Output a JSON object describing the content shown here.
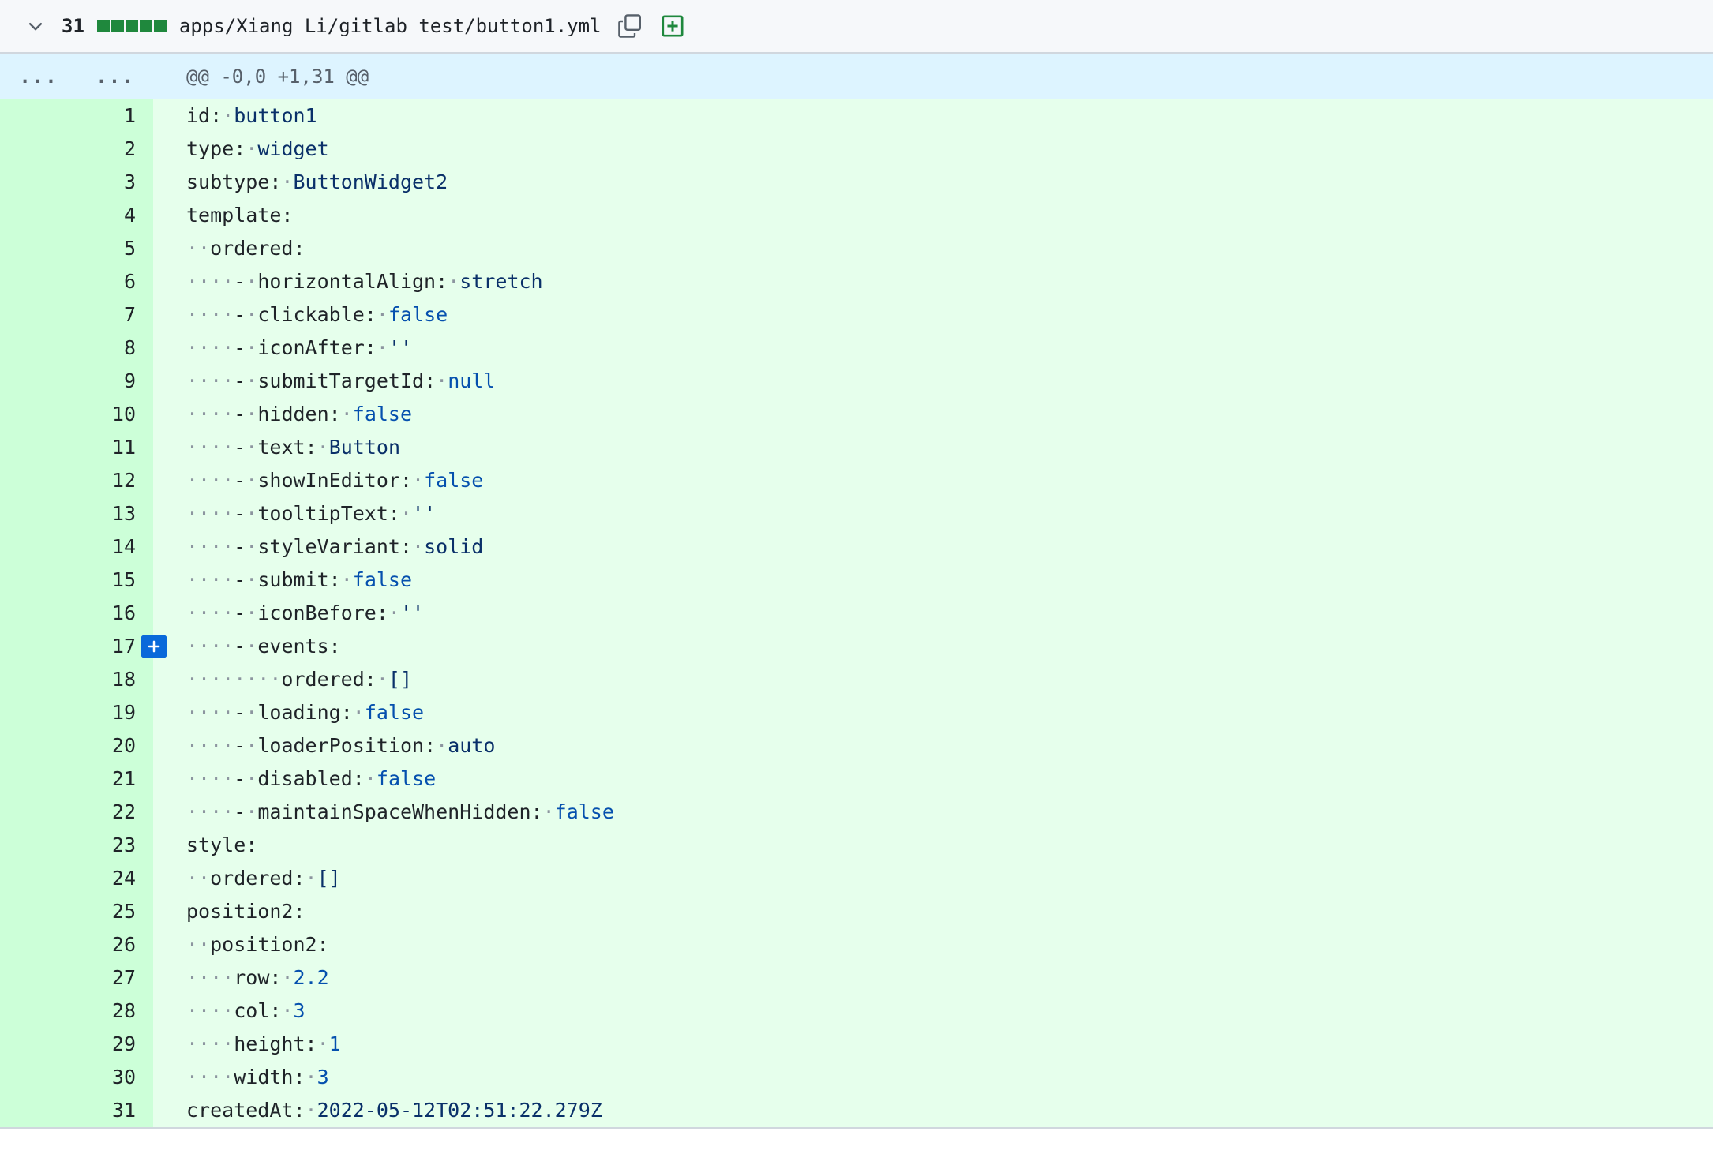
{
  "file": {
    "additions": "31",
    "diffstat_blocks": 5,
    "path": "apps/Xiang Li/gitlab test/button1.yml",
    "icons": [
      "chevron-down-icon",
      "copy-icon",
      "plus-square-icon"
    ]
  },
  "hunk": {
    "expand_old": "...",
    "expand_new": "...",
    "header": "@@ -0,0 +1,31 @@"
  },
  "lines": [
    {
      "n": "1",
      "indent": 0,
      "dash": false,
      "key": "id",
      "val": "button1",
      "vtype": "str"
    },
    {
      "n": "2",
      "indent": 0,
      "dash": false,
      "key": "type",
      "val": "widget",
      "vtype": "str"
    },
    {
      "n": "3",
      "indent": 0,
      "dash": false,
      "key": "subtype",
      "val": "ButtonWidget2",
      "vtype": "str"
    },
    {
      "n": "4",
      "indent": 0,
      "dash": false,
      "key": "template",
      "val": "",
      "vtype": "str"
    },
    {
      "n": "5",
      "indent": 2,
      "dash": false,
      "key": "ordered",
      "val": "",
      "vtype": "str"
    },
    {
      "n": "6",
      "indent": 4,
      "dash": true,
      "key": "horizontalAlign",
      "val": "stretch",
      "vtype": "str"
    },
    {
      "n": "7",
      "indent": 4,
      "dash": true,
      "key": "clickable",
      "val": "false",
      "vtype": "lit"
    },
    {
      "n": "8",
      "indent": 4,
      "dash": true,
      "key": "iconAfter",
      "val": "''",
      "vtype": "str"
    },
    {
      "n": "9",
      "indent": 4,
      "dash": true,
      "key": "submitTargetId",
      "val": "null",
      "vtype": "lit"
    },
    {
      "n": "10",
      "indent": 4,
      "dash": true,
      "key": "hidden",
      "val": "false",
      "vtype": "lit"
    },
    {
      "n": "11",
      "indent": 4,
      "dash": true,
      "key": "text",
      "val": "Button",
      "vtype": "str"
    },
    {
      "n": "12",
      "indent": 4,
      "dash": true,
      "key": "showInEditor",
      "val": "false",
      "vtype": "lit"
    },
    {
      "n": "13",
      "indent": 4,
      "dash": true,
      "key": "tooltipText",
      "val": "''",
      "vtype": "str"
    },
    {
      "n": "14",
      "indent": 4,
      "dash": true,
      "key": "styleVariant",
      "val": "solid",
      "vtype": "str"
    },
    {
      "n": "15",
      "indent": 4,
      "dash": true,
      "key": "submit",
      "val": "false",
      "vtype": "lit"
    },
    {
      "n": "16",
      "indent": 4,
      "dash": true,
      "key": "iconBefore",
      "val": "''",
      "vtype": "str"
    },
    {
      "n": "17",
      "indent": 4,
      "dash": true,
      "key": "events",
      "val": "",
      "vtype": "str",
      "comment_button": true
    },
    {
      "n": "18",
      "indent": 8,
      "dash": false,
      "key": "ordered",
      "val": "[]",
      "vtype": "str"
    },
    {
      "n": "19",
      "indent": 4,
      "dash": true,
      "key": "loading",
      "val": "false",
      "vtype": "lit"
    },
    {
      "n": "20",
      "indent": 4,
      "dash": true,
      "key": "loaderPosition",
      "val": "auto",
      "vtype": "str"
    },
    {
      "n": "21",
      "indent": 4,
      "dash": true,
      "key": "disabled",
      "val": "false",
      "vtype": "lit"
    },
    {
      "n": "22",
      "indent": 4,
      "dash": true,
      "key": "maintainSpaceWhenHidden",
      "val": "false",
      "vtype": "lit"
    },
    {
      "n": "23",
      "indent": 0,
      "dash": false,
      "key": "style",
      "val": "",
      "vtype": "str"
    },
    {
      "n": "24",
      "indent": 2,
      "dash": false,
      "key": "ordered",
      "val": "[]",
      "vtype": "str"
    },
    {
      "n": "25",
      "indent": 0,
      "dash": false,
      "key": "position2",
      "val": "",
      "vtype": "str"
    },
    {
      "n": "26",
      "indent": 2,
      "dash": false,
      "key": "position2",
      "val": "",
      "vtype": "str"
    },
    {
      "n": "27",
      "indent": 4,
      "dash": false,
      "key": "row",
      "val": "2.2",
      "vtype": "lit"
    },
    {
      "n": "28",
      "indent": 4,
      "dash": false,
      "key": "col",
      "val": "3",
      "vtype": "lit"
    },
    {
      "n": "29",
      "indent": 4,
      "dash": false,
      "key": "height",
      "val": "1",
      "vtype": "lit"
    },
    {
      "n": "30",
      "indent": 4,
      "dash": false,
      "key": "width",
      "val": "3",
      "vtype": "lit"
    },
    {
      "n": "31",
      "indent": 0,
      "dash": false,
      "key": "createdAt",
      "val": "2022-05-12T02:51:22.279Z",
      "vtype": "str"
    }
  ],
  "colors": {
    "added_gutter": "#ccffd8",
    "added_code": "#e6ffec",
    "hunk_bg": "#ddf4ff",
    "diffstat_green": "#1f883d",
    "comment_button": "#0969da"
  }
}
